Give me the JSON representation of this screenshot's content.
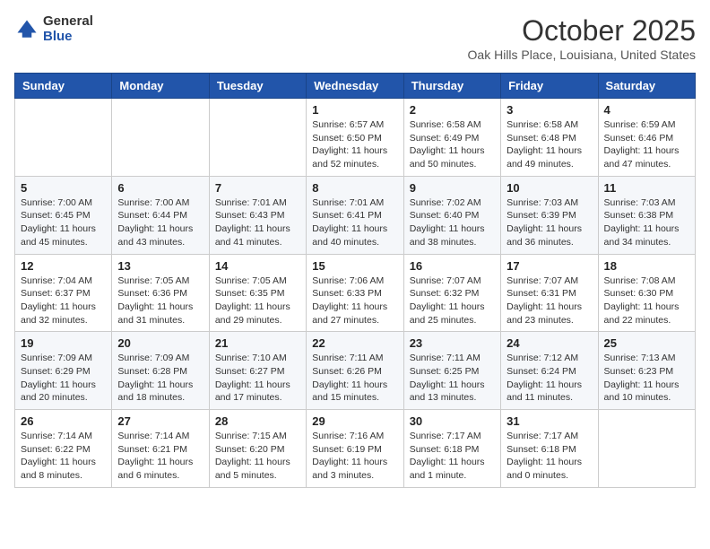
{
  "logo": {
    "general": "General",
    "blue": "Blue"
  },
  "title": "October 2025",
  "location": "Oak Hills Place, Louisiana, United States",
  "days_of_week": [
    "Sunday",
    "Monday",
    "Tuesday",
    "Wednesday",
    "Thursday",
    "Friday",
    "Saturday"
  ],
  "weeks": [
    [
      {
        "day": "",
        "info": ""
      },
      {
        "day": "",
        "info": ""
      },
      {
        "day": "",
        "info": ""
      },
      {
        "day": "1",
        "info": "Sunrise: 6:57 AM\nSunset: 6:50 PM\nDaylight: 11 hours and 52 minutes."
      },
      {
        "day": "2",
        "info": "Sunrise: 6:58 AM\nSunset: 6:49 PM\nDaylight: 11 hours and 50 minutes."
      },
      {
        "day": "3",
        "info": "Sunrise: 6:58 AM\nSunset: 6:48 PM\nDaylight: 11 hours and 49 minutes."
      },
      {
        "day": "4",
        "info": "Sunrise: 6:59 AM\nSunset: 6:46 PM\nDaylight: 11 hours and 47 minutes."
      }
    ],
    [
      {
        "day": "5",
        "info": "Sunrise: 7:00 AM\nSunset: 6:45 PM\nDaylight: 11 hours and 45 minutes."
      },
      {
        "day": "6",
        "info": "Sunrise: 7:00 AM\nSunset: 6:44 PM\nDaylight: 11 hours and 43 minutes."
      },
      {
        "day": "7",
        "info": "Sunrise: 7:01 AM\nSunset: 6:43 PM\nDaylight: 11 hours and 41 minutes."
      },
      {
        "day": "8",
        "info": "Sunrise: 7:01 AM\nSunset: 6:41 PM\nDaylight: 11 hours and 40 minutes."
      },
      {
        "day": "9",
        "info": "Sunrise: 7:02 AM\nSunset: 6:40 PM\nDaylight: 11 hours and 38 minutes."
      },
      {
        "day": "10",
        "info": "Sunrise: 7:03 AM\nSunset: 6:39 PM\nDaylight: 11 hours and 36 minutes."
      },
      {
        "day": "11",
        "info": "Sunrise: 7:03 AM\nSunset: 6:38 PM\nDaylight: 11 hours and 34 minutes."
      }
    ],
    [
      {
        "day": "12",
        "info": "Sunrise: 7:04 AM\nSunset: 6:37 PM\nDaylight: 11 hours and 32 minutes."
      },
      {
        "day": "13",
        "info": "Sunrise: 7:05 AM\nSunset: 6:36 PM\nDaylight: 11 hours and 31 minutes."
      },
      {
        "day": "14",
        "info": "Sunrise: 7:05 AM\nSunset: 6:35 PM\nDaylight: 11 hours and 29 minutes."
      },
      {
        "day": "15",
        "info": "Sunrise: 7:06 AM\nSunset: 6:33 PM\nDaylight: 11 hours and 27 minutes."
      },
      {
        "day": "16",
        "info": "Sunrise: 7:07 AM\nSunset: 6:32 PM\nDaylight: 11 hours and 25 minutes."
      },
      {
        "day": "17",
        "info": "Sunrise: 7:07 AM\nSunset: 6:31 PM\nDaylight: 11 hours and 23 minutes."
      },
      {
        "day": "18",
        "info": "Sunrise: 7:08 AM\nSunset: 6:30 PM\nDaylight: 11 hours and 22 minutes."
      }
    ],
    [
      {
        "day": "19",
        "info": "Sunrise: 7:09 AM\nSunset: 6:29 PM\nDaylight: 11 hours and 20 minutes."
      },
      {
        "day": "20",
        "info": "Sunrise: 7:09 AM\nSunset: 6:28 PM\nDaylight: 11 hours and 18 minutes."
      },
      {
        "day": "21",
        "info": "Sunrise: 7:10 AM\nSunset: 6:27 PM\nDaylight: 11 hours and 17 minutes."
      },
      {
        "day": "22",
        "info": "Sunrise: 7:11 AM\nSunset: 6:26 PM\nDaylight: 11 hours and 15 minutes."
      },
      {
        "day": "23",
        "info": "Sunrise: 7:11 AM\nSunset: 6:25 PM\nDaylight: 11 hours and 13 minutes."
      },
      {
        "day": "24",
        "info": "Sunrise: 7:12 AM\nSunset: 6:24 PM\nDaylight: 11 hours and 11 minutes."
      },
      {
        "day": "25",
        "info": "Sunrise: 7:13 AM\nSunset: 6:23 PM\nDaylight: 11 hours and 10 minutes."
      }
    ],
    [
      {
        "day": "26",
        "info": "Sunrise: 7:14 AM\nSunset: 6:22 PM\nDaylight: 11 hours and 8 minutes."
      },
      {
        "day": "27",
        "info": "Sunrise: 7:14 AM\nSunset: 6:21 PM\nDaylight: 11 hours and 6 minutes."
      },
      {
        "day": "28",
        "info": "Sunrise: 7:15 AM\nSunset: 6:20 PM\nDaylight: 11 hours and 5 minutes."
      },
      {
        "day": "29",
        "info": "Sunrise: 7:16 AM\nSunset: 6:19 PM\nDaylight: 11 hours and 3 minutes."
      },
      {
        "day": "30",
        "info": "Sunrise: 7:17 AM\nSunset: 6:18 PM\nDaylight: 11 hours and 1 minute."
      },
      {
        "day": "31",
        "info": "Sunrise: 7:17 AM\nSunset: 6:18 PM\nDaylight: 11 hours and 0 minutes."
      },
      {
        "day": "",
        "info": ""
      }
    ]
  ]
}
